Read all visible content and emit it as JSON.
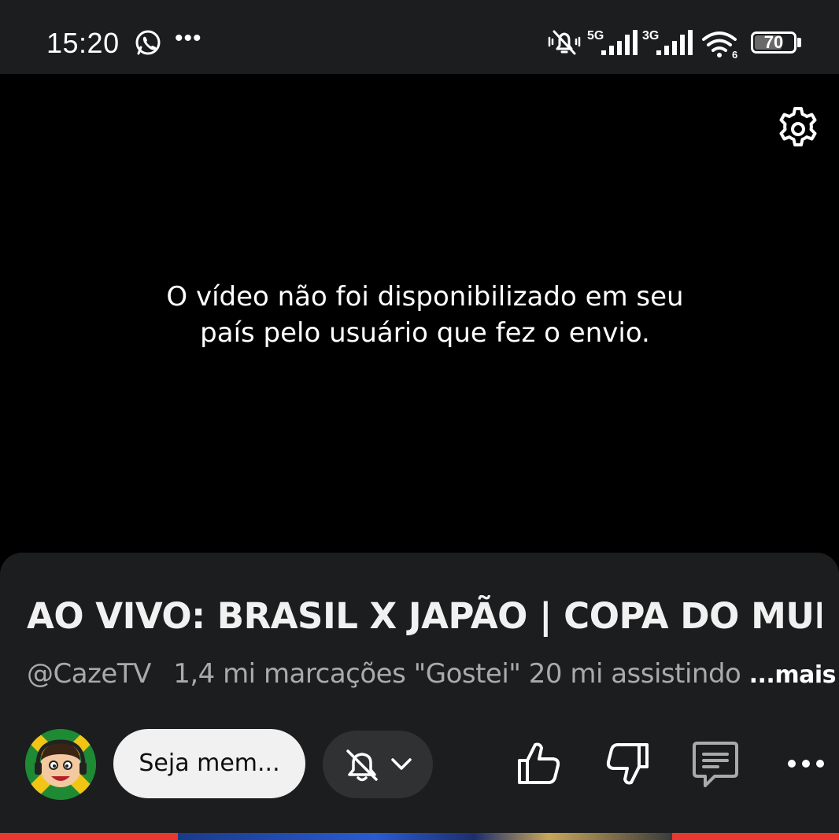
{
  "status_bar": {
    "time": "15:20",
    "network_1": "5G",
    "network_2": "3G",
    "wifi_badge": "6",
    "battery_text": "70",
    "battery_level": 0.7,
    "icons": [
      "whatsapp-icon",
      "more-notifications-icon",
      "muted-bell-icon",
      "signal-icon",
      "signal-icon",
      "wifi-icon",
      "battery-icon"
    ]
  },
  "video": {
    "message_line1": "O vídeo não foi disponibilizado em seu",
    "message_line2": "país pelo usuário que fez o envio."
  },
  "info": {
    "title": "AO VIVO: BRASIL X JAPÃO | COPA DO MUN...",
    "handle": "@CazeTV",
    "likes": "1,4 mi marcações \"Gostei\"",
    "watching": "20 mi assistindo",
    "more_label": "...mais"
  },
  "actions": {
    "join_label": "Seja mem...",
    "colors": {
      "panel_bg": "#1b1d1e",
      "join_bg": "#f1f1f1",
      "bell_bg": "#2f3133",
      "accent_red": "#e8382f"
    }
  }
}
